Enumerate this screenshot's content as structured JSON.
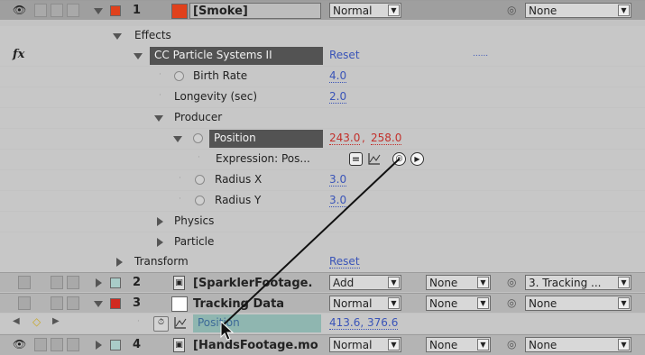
{
  "colors": {
    "smoke_label": "#e0411c",
    "tracking_label": "#d02a20",
    "value_blue": "#3a54b8",
    "value_red": "#c2302b",
    "highlight_dark": "#535353",
    "highlight_teal": "#8fb6b0"
  },
  "layer1": {
    "number": "1",
    "name": "[Smoke]",
    "mode": "Normal",
    "parent": "None"
  },
  "effects_label": "Effects",
  "fx_badge": "fx",
  "effect": {
    "name": "CC Particle Systems II",
    "reset": "Reset",
    "dots": "......"
  },
  "birth_rate": {
    "label": "Birth Rate",
    "value": "4.0"
  },
  "longevity": {
    "label": "Longevity (sec)",
    "value": "2.0"
  },
  "producer_label": "Producer",
  "position": {
    "label": "Position",
    "value_x": "243.0",
    "sep": ",",
    "value_y": "258.0"
  },
  "expression": {
    "label": "Expression: Pos...",
    "equals_icon": "=",
    "graph_icon": "graph-icon",
    "pickwhip_icon": "pickwhip-icon",
    "menu_icon": "expression-menu-icon"
  },
  "radius_x": {
    "label": "Radius X",
    "value": "3.0"
  },
  "radius_y": {
    "label": "Radius Y",
    "value": "3.0"
  },
  "physics_label": "Physics",
  "particle_label": "Particle",
  "transform": {
    "label": "Transform",
    "reset": "Reset"
  },
  "layer2": {
    "number": "2",
    "name": "[SparklerFootage.",
    "mode": "Add",
    "trkmat": "None",
    "parent": "3. Tracking ..."
  },
  "layer3": {
    "number": "3",
    "name": "Tracking Data",
    "mode": "Normal",
    "trkmat": "None",
    "parent": "None"
  },
  "tracking_position": {
    "label": "Position",
    "value": "413.6, 376.6"
  },
  "layer4": {
    "number": "4",
    "name": "[HandsFootage.mo",
    "mode": "Normal",
    "trkmat": "None",
    "parent": "None"
  }
}
